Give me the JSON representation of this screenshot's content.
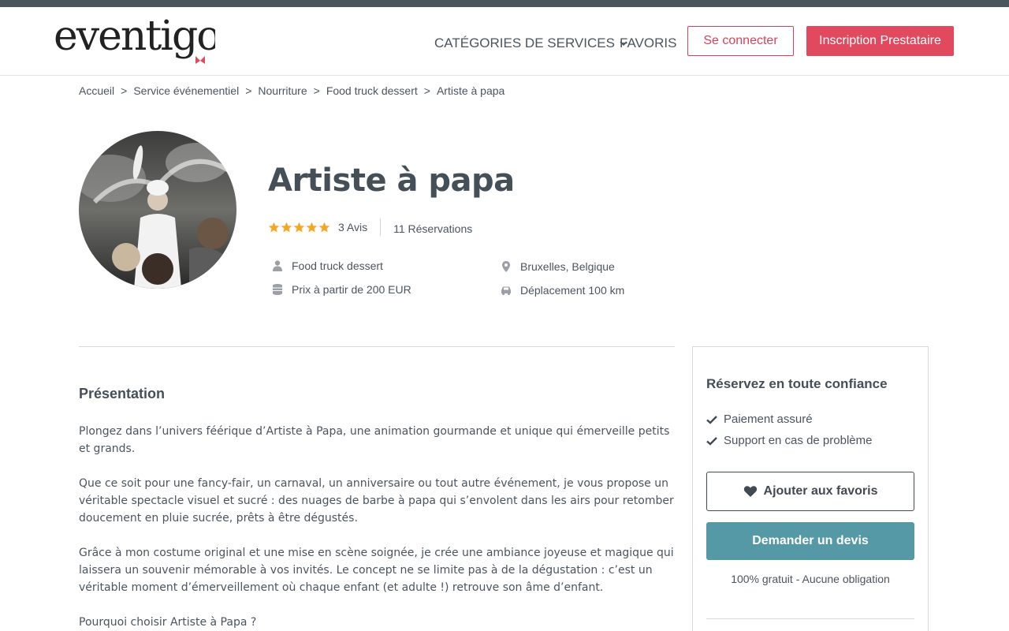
{
  "header": {
    "logo_text": "eventigo",
    "nav": {
      "categories": "CATÉGORIES DE SERVICES",
      "favorites": "FAVORIS"
    },
    "login": "Se connecter",
    "signup": "Inscription Prestataire"
  },
  "breadcrumb": [
    "Accueil",
    "Service événementiel",
    "Nourriture",
    "Food truck dessert",
    "Artiste à papa"
  ],
  "profile": {
    "title": "Artiste à papa",
    "rating": 5,
    "reviews": "3 Avis",
    "reservations": "11 Réservations",
    "category": "Food truck dessert",
    "price": "Prix à partir de 200 EUR",
    "location": "Bruxelles, Belgique",
    "travel": "Déplacement 100 km"
  },
  "presentation": {
    "heading": "Présentation",
    "p1": "Plongez dans l’univers féérique d’Artiste à Papa, une animation gourmande et unique qui émerveille petits et grands.",
    "p2": "Que ce soit pour une fancy-fair, un carnaval, un anniversaire ou tout autre événement, je vous propose un véritable spectacle visuel et sucré : des nuages de barbe à papa qui s’envolent dans les airs pour retomber doucement en pluie sucrée, prêts à être dégustés.",
    "p3": "Grâce à mon costume original et une mise en scène soignée, je crée une ambiance joyeuse et magique qui laissera un souvenir mémorable à vos invités. Le concept ne se limite pas à de la dégustation : c’est un véritable moment d’émerveillement où chaque enfant (et adulte !) retrouve son âme d’enfant.",
    "p4": "Pourquoi choisir Artiste à Papa ?"
  },
  "sidebar": {
    "title": "Réservez en toute confiance",
    "check1": "Paiement assuré",
    "check2": "Support en cas de problème",
    "fav_button": "Ajouter aux favoris",
    "quote_button": "Demander un devis",
    "free": "100% gratuit - Aucune obligation"
  },
  "colors": {
    "accent": "#e0495e",
    "teal": "#5699a6",
    "star": "#f5a623",
    "topbar": "#4a5560"
  }
}
